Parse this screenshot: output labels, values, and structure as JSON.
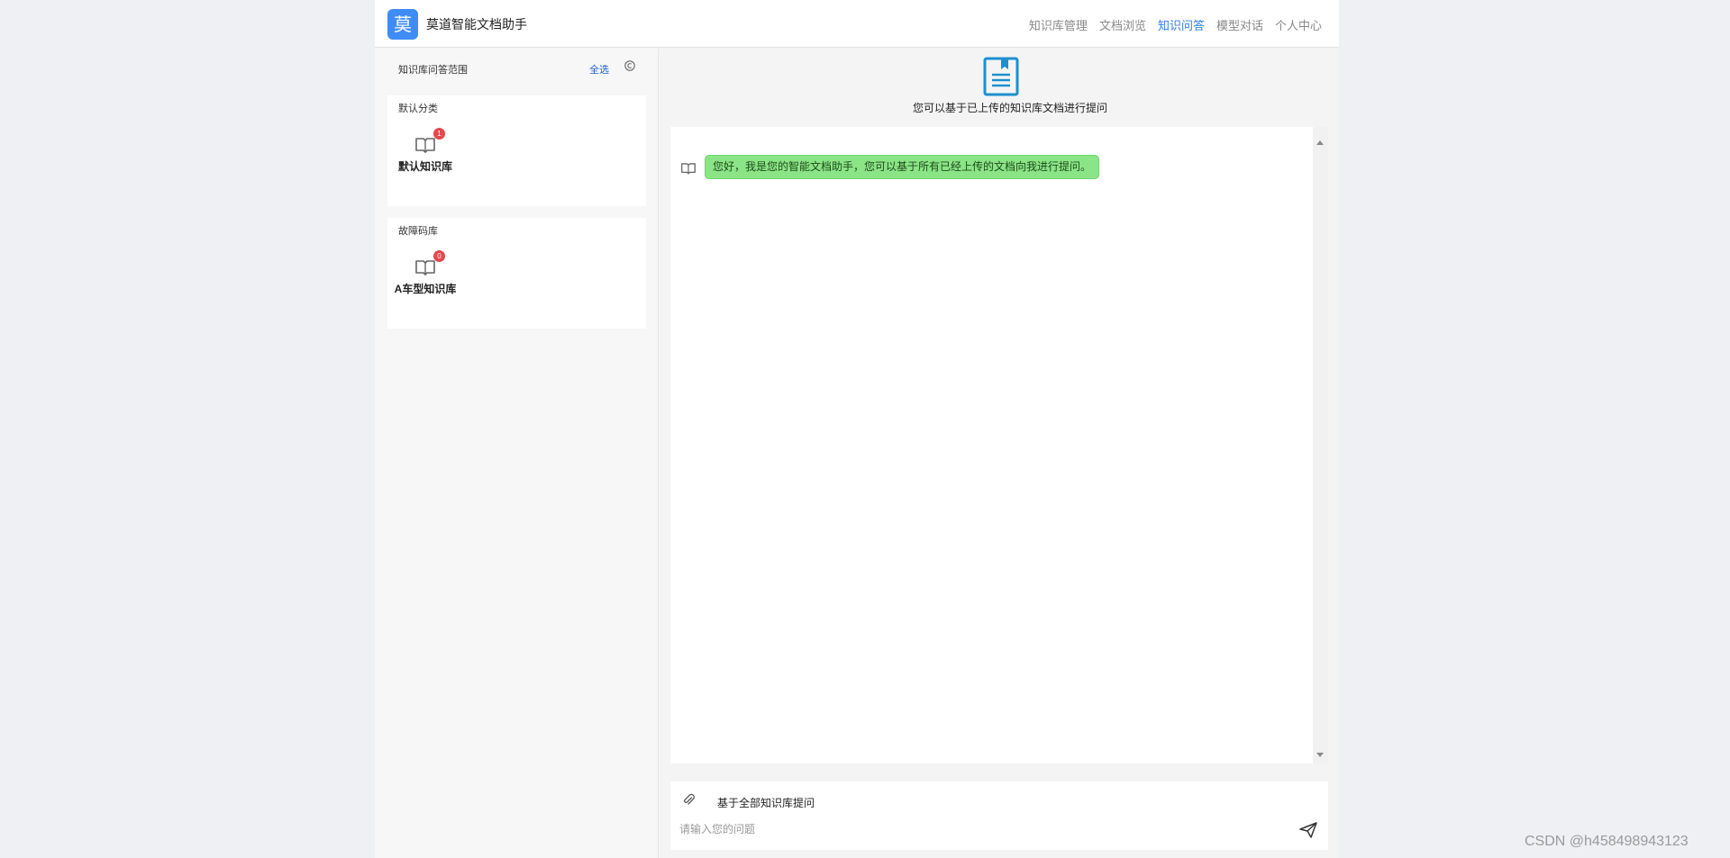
{
  "app": {
    "logo_char": "莫",
    "title": "莫道智能文档助手"
  },
  "nav": [
    {
      "label": "知识库管理",
      "active": false
    },
    {
      "label": "文档浏览",
      "active": false
    },
    {
      "label": "知识问答",
      "active": true
    },
    {
      "label": "模型对话",
      "active": false
    },
    {
      "label": "个人中心",
      "active": false
    }
  ],
  "sidebar": {
    "scope_title": "知识库问答范围",
    "select_all": "全选",
    "categories": [
      {
        "title": "默认分类",
        "kb": {
          "name": "默认知识库",
          "count": "1"
        }
      },
      {
        "title": "故障码库",
        "kb": {
          "name": "A车型知识库",
          "count": "0"
        }
      }
    ]
  },
  "main": {
    "intro_text": "您可以基于已上传的知识库文档进行提问",
    "messages": [
      {
        "role": "assistant",
        "text": "您好，我是您的智能文档助手，您可以基于所有已经上传的文档向我进行提问。"
      }
    ]
  },
  "composer": {
    "scope_label": "基于全部知识库提问",
    "placeholder": "请输入您的问题",
    "value": ""
  },
  "watermark": "CSDN @h458498943123",
  "colors": {
    "accent": "#2d7fe8",
    "logo_bg": "#3f8cf6",
    "bubble": "#8be486",
    "badge": "#e5484d"
  }
}
